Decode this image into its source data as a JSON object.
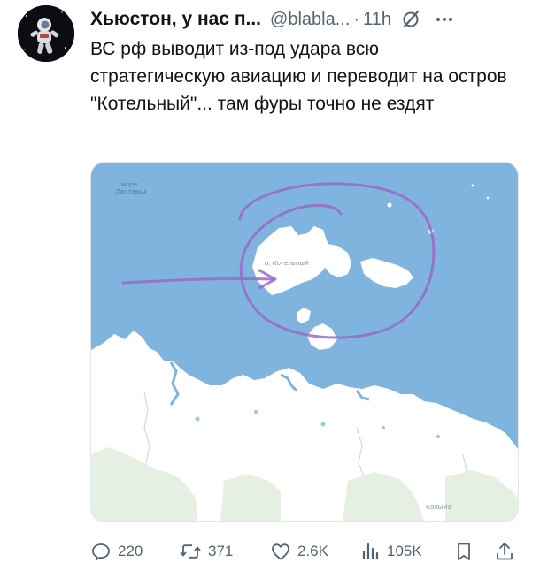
{
  "tweet": {
    "author_name": "Хьюстон, у нас п...",
    "handle": "@blabla...",
    "separator": "·",
    "time": "11h",
    "text": "ВС рф выводит из-под удара всю стратегическую авиацию и переводит на остров \"Котельный\"... там фуры точно не ездят"
  },
  "map": {
    "sea_label_line1": "море",
    "sea_label_line2": "Лаптевых",
    "island_label": "о. Котельный",
    "region_label": "Колыма",
    "water_color": "#7fb4de",
    "annotation_color": "#9a6ac4"
  },
  "actions": {
    "replies": "220",
    "retweets": "371",
    "likes": "2.6K",
    "views": "105K"
  },
  "icons": {
    "reply": "speech-bubble",
    "retweet": "retweet-arrows",
    "like": "heart-outline",
    "views": "bar-chart",
    "bookmark": "bookmark-outline",
    "share": "share-upload",
    "more": "three-dots",
    "grok": "slashed-circle"
  }
}
